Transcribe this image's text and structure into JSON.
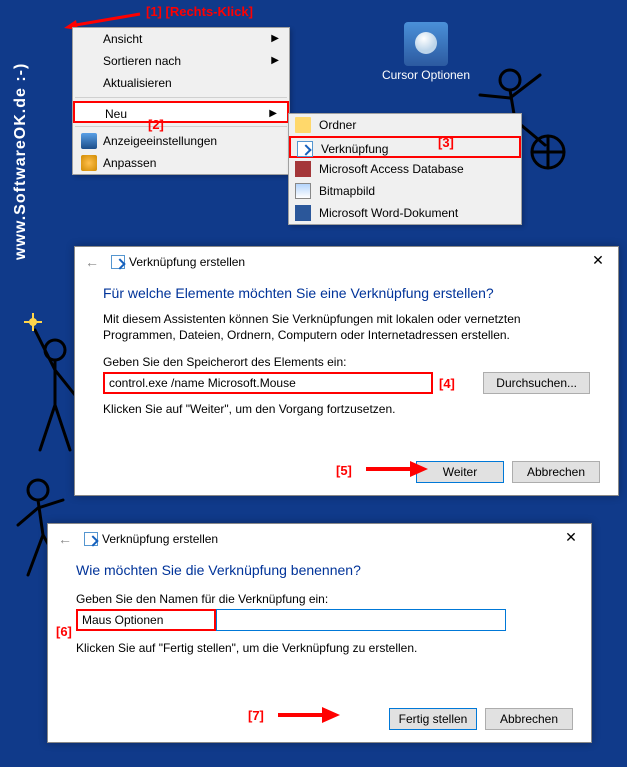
{
  "watermark": "www.SoftwareOK.de :-)",
  "annotations": {
    "a1": "[1]  [Rechts-Klick]",
    "a2": "[2]",
    "a3": "[3]",
    "a4": "[4]",
    "a5": "[5]",
    "a6": "[6]",
    "a7": "[7]"
  },
  "desktop_icon_label": "Cursor Optionen",
  "context_menu": {
    "items": [
      "Ansicht",
      "Sortieren nach",
      "Aktualisieren",
      "Neu",
      "Anzeigeeinstellungen",
      "Anpassen"
    ]
  },
  "submenu": {
    "items": [
      "Ordner",
      "Verknüpfung",
      "Microsoft Access Database",
      "Bitmapbild",
      "Microsoft Word-Dokument"
    ]
  },
  "dialog1": {
    "title": "Verknüpfung erstellen",
    "heading": "Für welche Elemente möchten Sie eine Verknüpfung erstellen?",
    "desc": "Mit diesem Assistenten können Sie Verknüpfungen mit lokalen oder vernetzten Programmen, Dateien, Ordnern, Computern oder Internetadressen erstellen.",
    "label": "Geben Sie den Speicherort des Elements ein:",
    "input_value": "control.exe /name Microsoft.Mouse",
    "browse": "Durchsuchen...",
    "hint": "Klicken Sie auf \"Weiter\", um den Vorgang fortzusetzen.",
    "next": "Weiter",
    "cancel": "Abbrechen"
  },
  "dialog2": {
    "title": "Verknüpfung erstellen",
    "heading": "Wie möchten Sie die Verknüpfung benennen?",
    "label": "Geben Sie den Namen für die Verknüpfung ein:",
    "input_value": "Maus Optionen",
    "hint": "Klicken Sie auf \"Fertig stellen\", um die Verknüpfung zu erstellen.",
    "finish": "Fertig stellen",
    "cancel": "Abbrechen"
  }
}
